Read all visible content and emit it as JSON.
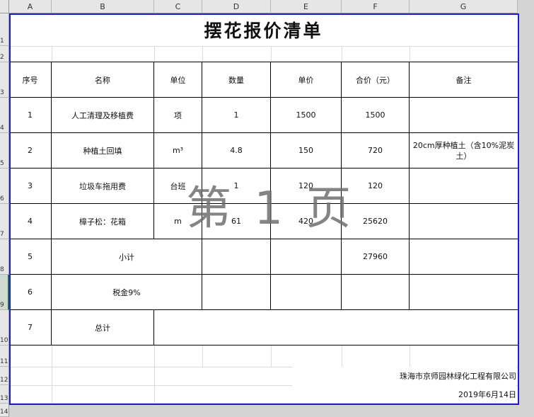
{
  "columns": [
    "A",
    "B",
    "C",
    "D",
    "E",
    "F",
    "G"
  ],
  "rows": [
    "1",
    "2",
    "3",
    "4",
    "5",
    "6",
    "7",
    "8",
    "9",
    "10",
    "11",
    "12",
    "13",
    "14"
  ],
  "title": "摆花报价清单",
  "watermark": "第 1 页",
  "headers": [
    "序号",
    "名称",
    "单位",
    "数量",
    "单价",
    "合价（元）",
    "备注"
  ],
  "items": [
    {
      "no": "1",
      "name": "人工清理及移植费",
      "unit": "项",
      "qty": "1",
      "price": "1500",
      "total": "1500",
      "note": ""
    },
    {
      "no": "2",
      "name": "种植土回填",
      "unit": "m³",
      "qty": "4.8",
      "price": "150",
      "total": "720",
      "note": "20cm厚种植土（含10%泥炭土）"
    },
    {
      "no": "3",
      "name": "垃圾车拖用费",
      "unit": "台班",
      "qty": "1",
      "price": "120",
      "total": "120",
      "note": ""
    },
    {
      "no": "4",
      "name": "樟子松：花箱",
      "unit": "m",
      "qty": "61",
      "price": "420",
      "total": "25620",
      "note": ""
    }
  ],
  "subtotal": {
    "no": "5",
    "label": "小计",
    "total": "27960"
  },
  "tax": {
    "no": "6",
    "label": "税金9%"
  },
  "grand": {
    "no": "7",
    "label": "总计"
  },
  "company": "珠海市京师园林绿化工程有限公司",
  "date": "2019年6月14日"
}
